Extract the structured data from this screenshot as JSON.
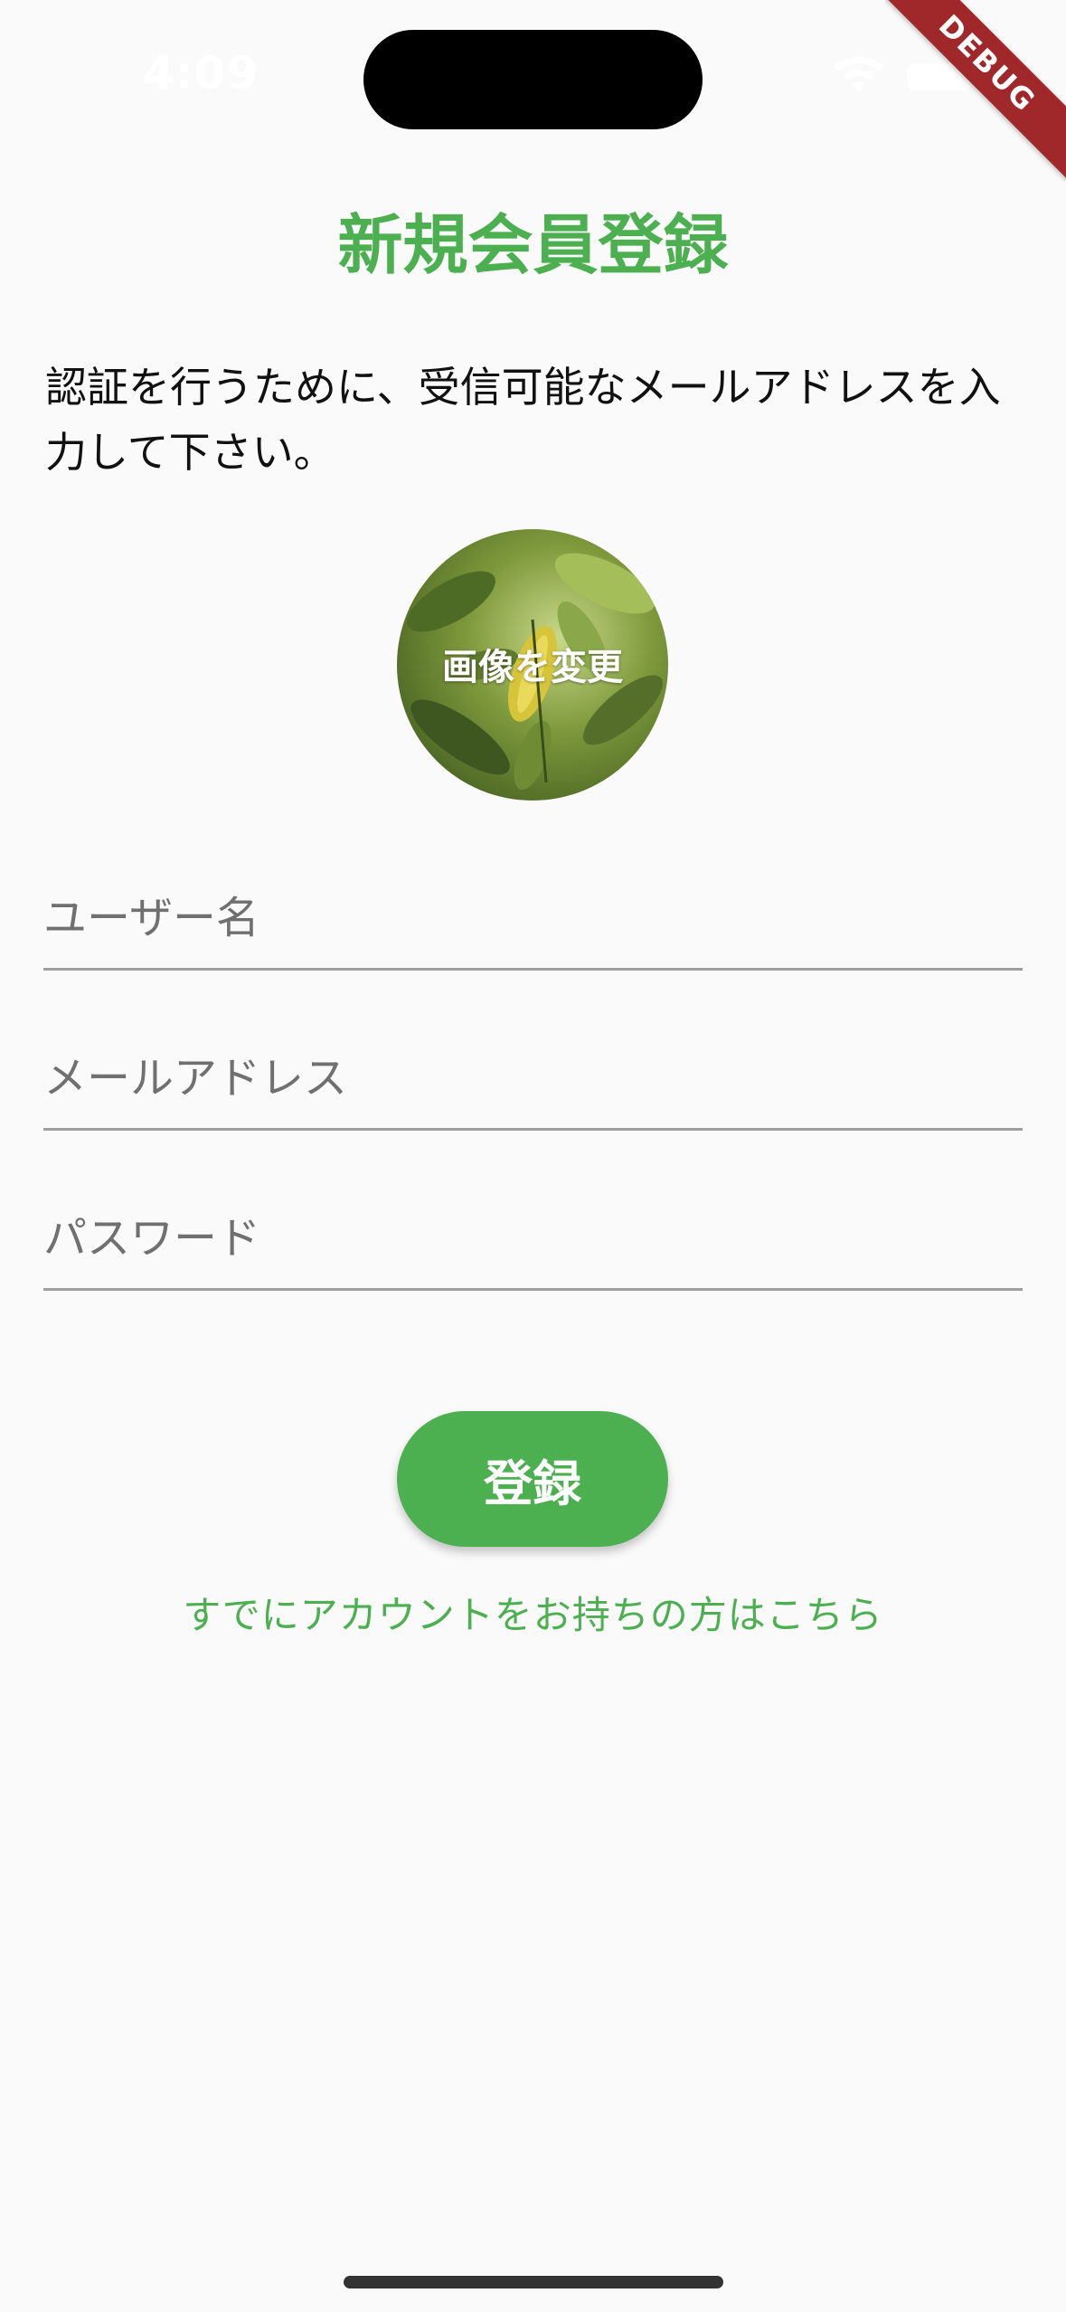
{
  "status_bar": {
    "time": "4:09",
    "debug_label": "DEBUG"
  },
  "header": {
    "title": "新規会員登録"
  },
  "description": "認証を行うために、受信可能なメールアドレスを入力して下さい。",
  "avatar": {
    "change_label": "画像を変更"
  },
  "form": {
    "username": {
      "placeholder": "ユーザー名",
      "value": ""
    },
    "email": {
      "placeholder": "メールアドレス",
      "value": ""
    },
    "password": {
      "placeholder": "パスワード",
      "value": ""
    }
  },
  "actions": {
    "register_label": "登録",
    "login_link": "すでにアカウントをお持ちの方はこちら"
  },
  "colors": {
    "accent": "#4caf50",
    "background": "#fafafa",
    "debug_ribbon": "#a0282b"
  }
}
